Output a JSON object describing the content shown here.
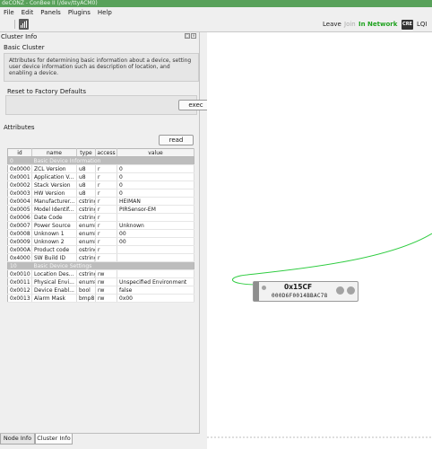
{
  "window": {
    "title": "deCONZ - ConBee II (/dev/ttyACM0)"
  },
  "menu": [
    "File",
    "Edit",
    "Panels",
    "Plugins",
    "Help"
  ],
  "toolbar": {
    "graph_icon": "bar-graph-icon",
    "leave_label": "Leave",
    "join_label": "Join",
    "network_status": "In Network",
    "cre_label": "CRE",
    "lqi_label": "LQI"
  },
  "panel": {
    "title": "Cluster Info",
    "cluster_name": "Basic Cluster",
    "cluster_description": "Attributes for determining basic information about a device, setting user device information such as description of location, and enabling a device.",
    "reset_title": "Reset to Factory Defaults",
    "exec_label": "exec",
    "attributes_title": "Attributes",
    "read_label": "read",
    "columns": [
      "id",
      "name",
      "type",
      "access",
      "value"
    ],
    "groups": {
      "info": {
        "id": "0",
        "name": "Basic Device Information"
      },
      "settings": {
        "id": "10",
        "name": "Basic Device Settings"
      }
    },
    "rows": [
      {
        "id": "0x0000",
        "name": "ZCL Version",
        "type": "u8",
        "access": "r",
        "value": "0"
      },
      {
        "id": "0x0001",
        "name": "Application V...",
        "type": "u8",
        "access": "r",
        "value": "0"
      },
      {
        "id": "0x0002",
        "name": "Stack Version",
        "type": "u8",
        "access": "r",
        "value": "0"
      },
      {
        "id": "0x0003",
        "name": "HW Version",
        "type": "u8",
        "access": "r",
        "value": "0"
      },
      {
        "id": "0x0004",
        "name": "Manufacturer...",
        "type": "cstring",
        "access": "r",
        "value": "HEIMAN"
      },
      {
        "id": "0x0005",
        "name": "Model Identif...",
        "type": "cstring",
        "access": "r",
        "value": "PIRSensor-EM"
      },
      {
        "id": "0x0006",
        "name": "Date Code",
        "type": "cstring",
        "access": "r",
        "value": ""
      },
      {
        "id": "0x0007",
        "name": "Power Source",
        "type": "enum8",
        "access": "r",
        "value": "Unknown"
      },
      {
        "id": "0x0008",
        "name": "Unknown 1",
        "type": "enum8",
        "access": "r",
        "value": "00"
      },
      {
        "id": "0x0009",
        "name": "Unknown 2",
        "type": "enum8",
        "access": "r",
        "value": "00"
      },
      {
        "id": "0x000A",
        "name": "Product code",
        "type": "ostring",
        "access": "r",
        "value": ""
      },
      {
        "id": "0x4000",
        "name": "SW Build ID",
        "type": "cstring",
        "access": "r",
        "value": ""
      },
      {
        "id": "0x0010",
        "name": "Location Des...",
        "type": "cstring",
        "access": "rw",
        "value": ""
      },
      {
        "id": "0x0011",
        "name": "Physical Envi...",
        "type": "enum8",
        "access": "rw",
        "value": "Unspecified Environment"
      },
      {
        "id": "0x0012",
        "name": "Device Enabl...",
        "type": "bool",
        "access": "rw",
        "value": "false"
      },
      {
        "id": "0x0013",
        "name": "Alarm Mask",
        "type": "bmp8",
        "access": "rw",
        "value": "0x00"
      }
    ]
  },
  "tabs": [
    "Node Info",
    "Cluster Info"
  ],
  "node": {
    "name": "0x15CF",
    "mac": "000D6F0014BBAC78"
  },
  "colors": {
    "link": "#2ecc40",
    "network": "#1ea21e",
    "titlebar": "#58a15a"
  }
}
